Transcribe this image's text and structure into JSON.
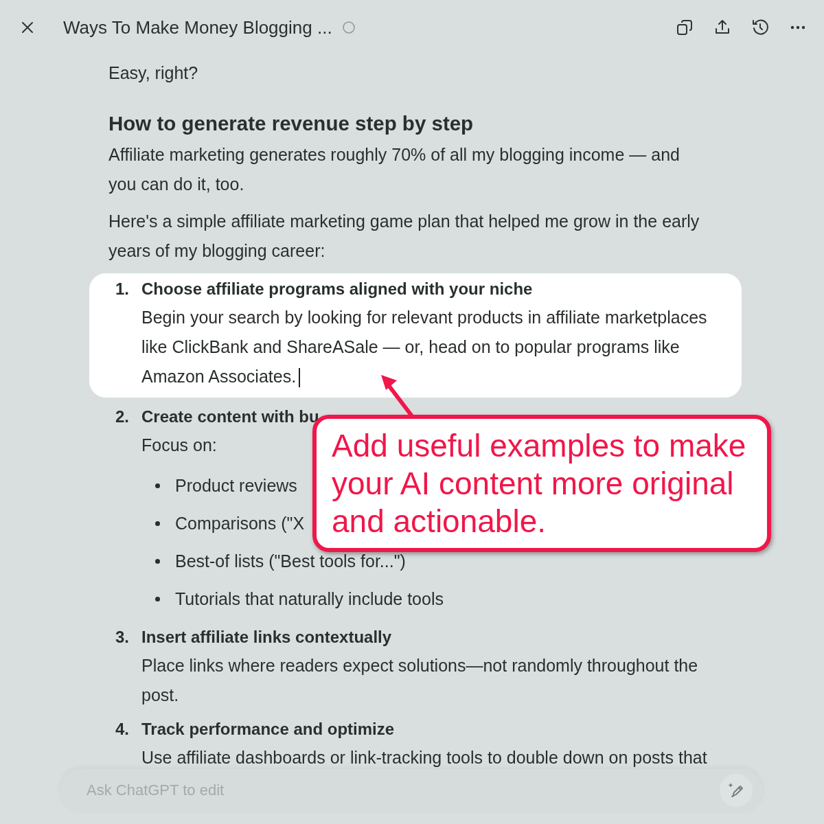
{
  "header": {
    "title": "Ways To Make Money Blogging ..."
  },
  "document": {
    "intro": "Easy, right?",
    "heading": "How to generate revenue step by step",
    "paragraphs": [
      "Affiliate marketing generates roughly 70% of all my blogging income — and you can do it, too.",
      "Here's a simple affiliate marketing game plan that helped me grow in the early years of my blogging career:"
    ],
    "steps": [
      {
        "number": "1.",
        "title": "Choose affiliate programs aligned with your niche",
        "highlighted": true,
        "has_cursor": true,
        "body": "Begin your search by looking for relevant products in affiliate marketplaces like ClickBank and ShareASale — or, head on to popular programs like Amazon Associates."
      },
      {
        "number": "2.",
        "title": "Create content with bu",
        "highlighted": false,
        "has_cursor": false,
        "body": "Focus on:",
        "bullets": [
          "Product reviews",
          "Comparisons (\"X",
          "Best-of lists (\"Best tools for...\")",
          "Tutorials that naturally include tools"
        ]
      },
      {
        "number": "3.",
        "title": "Insert affiliate links contextually",
        "highlighted": false,
        "has_cursor": false,
        "body": "Place links where readers expect solutions—not randomly throughout the post."
      },
      {
        "number": "4.",
        "title": "Track performance and optimize",
        "highlighted": false,
        "has_cursor": false,
        "body": "Use affiliate dashboards or link-tracking tools to double down on posts that"
      }
    ]
  },
  "callout": {
    "text": "Add useful examples to make your AI content more original and actionable."
  },
  "composer": {
    "placeholder": "Ask ChatGPT to edit"
  }
}
